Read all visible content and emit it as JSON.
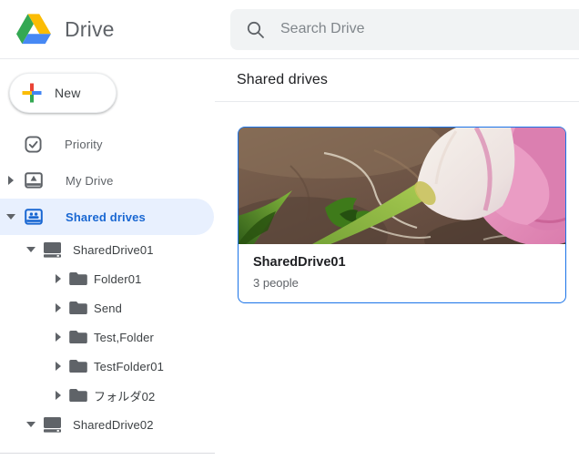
{
  "header": {
    "app_name": "Drive",
    "search": {
      "placeholder": "Search Drive",
      "value": ""
    }
  },
  "sidebar": {
    "new_button_label": "New",
    "items": [
      {
        "label": "Priority",
        "icon": "priority-check-icon",
        "level": 0,
        "arrow": "none",
        "selected": false
      },
      {
        "label": "My Drive",
        "icon": "my-drive-icon",
        "level": 0,
        "arrow": "right",
        "selected": false
      },
      {
        "label": "Shared drives",
        "icon": "shared-drives-icon",
        "level": 0,
        "arrow": "down",
        "selected": true
      },
      {
        "label": "SharedDrive01",
        "icon": "hard-drive-icon",
        "level": 1,
        "arrow": "down",
        "selected": false
      },
      {
        "label": "Folder01",
        "icon": "folder-icon",
        "level": 2,
        "arrow": "right",
        "selected": false
      },
      {
        "label": "Send",
        "icon": "folder-icon",
        "level": 2,
        "arrow": "right",
        "selected": false
      },
      {
        "label": "Test,Folder",
        "icon": "folder-icon",
        "level": 2,
        "arrow": "right",
        "selected": false
      },
      {
        "label": "TestFolder01",
        "icon": "folder-icon",
        "level": 2,
        "arrow": "right",
        "selected": false
      },
      {
        "label": "フォルダ02",
        "icon": "folder-icon",
        "level": 2,
        "arrow": "right",
        "selected": false
      },
      {
        "label": "SharedDrive02",
        "icon": "hard-drive-icon",
        "level": 1,
        "arrow": "down",
        "selected": false
      }
    ]
  },
  "main": {
    "heading": "Shared drives",
    "cards": [
      {
        "title": "SharedDrive01",
        "subtitle": "3 people",
        "selected": true,
        "thumbnail": "pink-tulip-photo"
      }
    ]
  },
  "colors": {
    "accent_blue": "#1a73e8",
    "selected_text": "#1967d2",
    "selected_bg": "#e8f0fe",
    "text_primary": "#202124",
    "text_secondary": "#5f6368",
    "search_bg": "#f1f3f4",
    "divider": "#dadce0",
    "logo_green": "#34a853",
    "logo_yellow": "#fbbc05",
    "logo_blue": "#4688f4",
    "plus_red": "#ea4335"
  }
}
